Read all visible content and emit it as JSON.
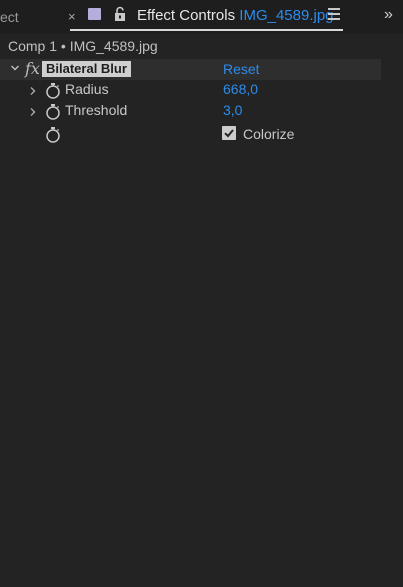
{
  "tabbar": {
    "prev_tab_label": "ect",
    "close_glyph": "×",
    "title": "Effect Controls",
    "file": "IMG_4589.jpg",
    "overflow_glyph": "»"
  },
  "breadcrumb": "Comp 1 • IMG_4589.jpg",
  "effect": {
    "name": "Bilateral Blur",
    "fx_glyph": "fx",
    "reset_label": "Reset",
    "properties": [
      {
        "label": "Radius",
        "value": "668,0"
      },
      {
        "label": "Threshold",
        "value": "3,0"
      }
    ],
    "colorize": {
      "label": "Colorize",
      "checked": true
    }
  },
  "colors": {
    "accent": "#2d8ceb",
    "background": "#232323",
    "tab_swatch": "#b6addd"
  },
  "icons": [
    "close-icon",
    "label-color-swatch",
    "lock-icon",
    "panel-menu-icon",
    "overflow-icon",
    "chevron-down-icon",
    "chevron-right-icon",
    "stopwatch-icon",
    "checkbox-icon"
  ]
}
